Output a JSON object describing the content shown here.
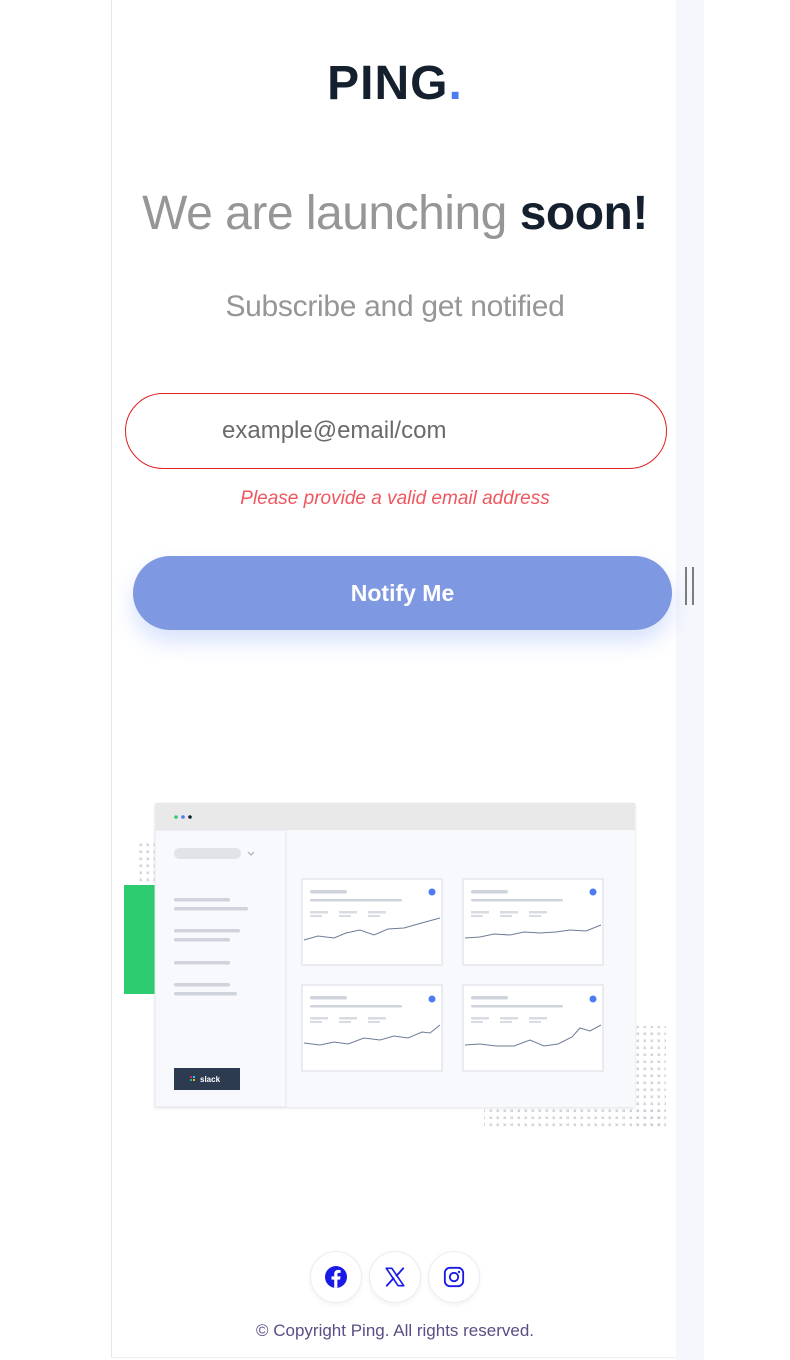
{
  "logo": {
    "text": "PING",
    "dot": ".",
    "dot_color": "#4c7bf3"
  },
  "headline": {
    "light": "We are launching ",
    "bold": "soon!"
  },
  "subtitle": "Subscribe and get notified",
  "form": {
    "email_placeholder": "example@email/com",
    "email_value": "",
    "error": "Please provide a valid email address",
    "button": "Notify Me"
  },
  "illustration": {
    "button_text": "slack",
    "accent_green": "#2ecc71",
    "window_dots": [
      "#2ecc71",
      "#4c7bf3",
      "#15202e"
    ]
  },
  "socials": [
    {
      "name": "facebook",
      "icon": "facebook-icon"
    },
    {
      "name": "x",
      "icon": "x-icon"
    },
    {
      "name": "instagram",
      "icon": "instagram-icon"
    }
  ],
  "footer": {
    "copyright": "© Copyright Ping. All rights reserved."
  },
  "colors": {
    "brand_blue": "#4c7bf3",
    "button": "#7f98e2",
    "error": "#f0565e",
    "dark": "#15202e"
  }
}
